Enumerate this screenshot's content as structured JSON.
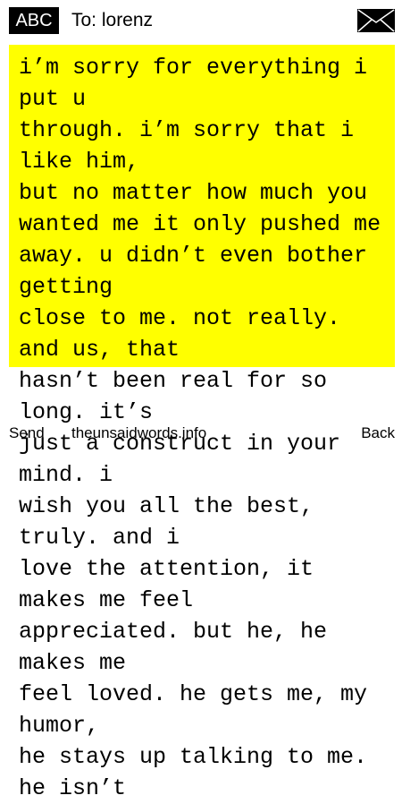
{
  "header": {
    "mode_label": "ABC",
    "recipient": "To: lorenz",
    "icon": "envelope-icon"
  },
  "message": {
    "text": "i’m sorry for everything i put u\nthrough. i’m sorry that i like him,\nbut no matter how much you\nwanted me it only pushed me\naway. u didn’t even bother getting\nclose to me. not really. and us, that\nhasn’t been real for so long. it’s\njust a construct in your mind. i\nwish you all the best, truly. and i\nlove the attention, it makes me feel\nappreciated. but he, he makes me\nfeel loved. he gets me, my humor,\nhe stays up talking to me. he isn’t",
    "highlight_color": "#ffff00"
  },
  "footer": {
    "send_label": "Send",
    "site_label": "theunsaidwords.info",
    "back_label": "Back"
  }
}
